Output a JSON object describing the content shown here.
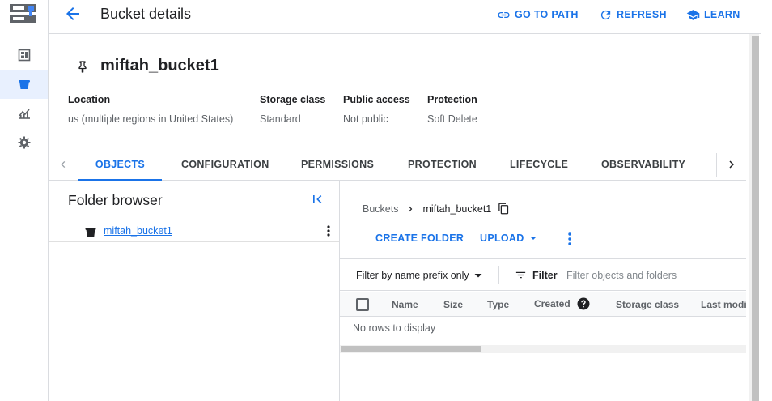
{
  "header": {
    "title": "Bucket details",
    "go_to_path": "GO TO PATH",
    "refresh": "REFRESH",
    "learn": "LEARN"
  },
  "bucket": {
    "name": "miftah_bucket1",
    "meta": [
      {
        "label": "Location",
        "value": "us (multiple regions in United States)"
      },
      {
        "label": "Storage class",
        "value": "Standard"
      },
      {
        "label": "Public access",
        "value": "Not public"
      },
      {
        "label": "Protection",
        "value": "Soft Delete"
      }
    ]
  },
  "tabs": [
    {
      "label": "OBJECTS"
    },
    {
      "label": "CONFIGURATION"
    },
    {
      "label": "PERMISSIONS"
    },
    {
      "label": "PROTECTION"
    },
    {
      "label": "LIFECYCLE"
    },
    {
      "label": "OBSERVABILITY"
    }
  ],
  "folder_browser": {
    "title": "Folder browser",
    "item": "miftah_bucket1"
  },
  "objects": {
    "breadcrumb": [
      "Buckets",
      "miftah_bucket1"
    ],
    "create_folder": "CREATE FOLDER",
    "upload": "UPLOAD",
    "filter_select": "Filter by name prefix only",
    "filter_label": "Filter",
    "filter_placeholder": "Filter objects and folders",
    "columns": [
      "Name",
      "Size",
      "Type",
      "Created",
      "Storage class",
      "Last modified"
    ],
    "empty": "No rows to display"
  },
  "colors": {
    "accent": "#1a73e8",
    "active_nav_bg": "#e8f0fe",
    "border": "#dadce0"
  },
  "icons": {
    "rail": [
      "storage-logo-icon",
      "dashboard-icon",
      "bucket-icon",
      "monitoring-icon",
      "settings-icon"
    ]
  }
}
